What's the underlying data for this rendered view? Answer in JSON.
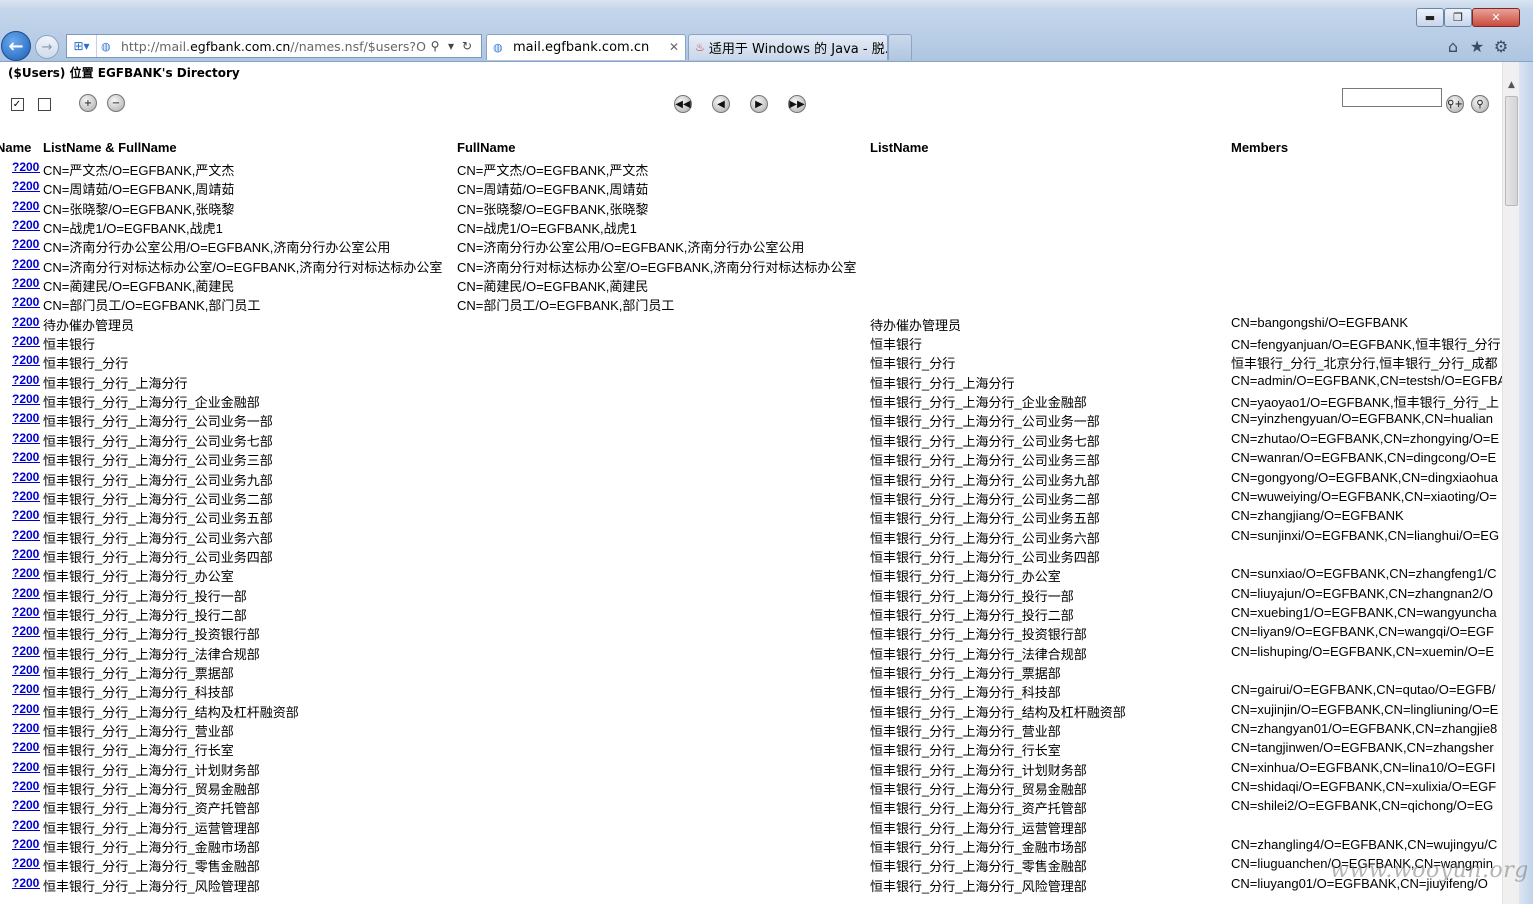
{
  "browser": {
    "address_url_prefix": "http://mail.",
    "address_url_domain": "egfbank.com.cn",
    "address_url_rest": "//names.nsf/$users?Oper",
    "tabs": [
      {
        "label": "mail.egfbank.com.cn",
        "active": true
      },
      {
        "label": "适用于 Windows 的 Java - 脱...",
        "active": false
      }
    ],
    "window_buttons": {
      "minimize": "▬",
      "maximize": "❐",
      "close": "✕"
    },
    "icons": [
      "back-arrow-icon",
      "forward-arrow-icon",
      "compat-view-icon",
      "favicon-icon",
      "search-icon",
      "dropdown-icon",
      "refresh-icon",
      "close-icon",
      "home-icon",
      "star-icon",
      "gear-icon"
    ]
  },
  "view": {
    "title": "($Users) 位置 EGFBANK's Directory",
    "toolbar_icons": [
      "select-all-icon",
      "deselect-all-icon",
      "expand-all-icon",
      "collapse-all-icon",
      "first-page-icon",
      "previous-page-icon",
      "next-page-icon",
      "last-page-icon",
      "search-options-icon",
      "search-icon"
    ],
    "columns": [
      "Name",
      "ListName & FullName",
      "FullName",
      "ListName",
      "Members"
    ],
    "rows": [
      {
        "link": "?2000",
        "name": "CN=严文杰/O=EGFBANK,严文杰",
        "fullname": "CN=严文杰/O=EGFBANK,严文杰",
        "listname": "",
        "members": ""
      },
      {
        "link": "?2000",
        "name": "CN=周靖茹/O=EGFBANK,周靖茹",
        "fullname": "CN=周靖茹/O=EGFBANK,周靖茹",
        "listname": "",
        "members": ""
      },
      {
        "link": "?2000",
        "name": "CN=张晓黎/O=EGFBANK,张晓黎",
        "fullname": "CN=张晓黎/O=EGFBANK,张晓黎",
        "listname": "",
        "members": ""
      },
      {
        "link": "?2000",
        "name": "CN=战虎1/O=EGFBANK,战虎1",
        "fullname": "CN=战虎1/O=EGFBANK,战虎1",
        "listname": "",
        "members": ""
      },
      {
        "link": "?2000",
        "name": "CN=济南分行办公室公用/O=EGFBANK,济南分行办公室公用",
        "fullname": "CN=济南分行办公室公用/O=EGFBANK,济南分行办公室公用",
        "listname": "",
        "members": ""
      },
      {
        "link": "?2000",
        "name": "CN=济南分行对标达标办公室/O=EGFBANK,济南分行对标达标办公室",
        "fullname": "CN=济南分行对标达标办公室/O=EGFBANK,济南分行对标达标办公室",
        "listname": "",
        "members": ""
      },
      {
        "link": "?2000",
        "name": "CN=蔺建民/O=EGFBANK,蔺建民",
        "fullname": "CN=蔺建民/O=EGFBANK,蔺建民",
        "listname": "",
        "members": ""
      },
      {
        "link": "?2000",
        "name": "CN=部门员工/O=EGFBANK,部门员工",
        "fullname": "CN=部门员工/O=EGFBANK,部门员工",
        "listname": "",
        "members": ""
      },
      {
        "link": "?2000",
        "name": "待办催办管理员",
        "fullname": "",
        "listname": "待办催办管理员",
        "members": "CN=bangongshi/O=EGFBANK"
      },
      {
        "link": "?2000",
        "name": "恒丰银行",
        "fullname": "",
        "listname": "恒丰银行",
        "members": "CN=fengyanjuan/O=EGFBANK,恒丰银行_分行"
      },
      {
        "link": "?2000",
        "name": "恒丰银行_分行",
        "fullname": "",
        "listname": "恒丰银行_分行",
        "members": "恒丰银行_分行_北京分行,恒丰银行_分行_成都"
      },
      {
        "link": "?2000",
        "name": "恒丰银行_分行_上海分行",
        "fullname": "",
        "listname": "恒丰银行_分行_上海分行",
        "members": "CN=admin/O=EGFBANK,CN=testsh/O=EGFBANK"
      },
      {
        "link": "?2000",
        "name": "恒丰银行_分行_上海分行_企业金融部",
        "fullname": "",
        "listname": "恒丰银行_分行_上海分行_企业金融部",
        "members": "CN=yaoyao1/O=EGFBANK,恒丰银行_分行_上"
      },
      {
        "link": "?2000",
        "name": "恒丰银行_分行_上海分行_公司业务一部",
        "fullname": "",
        "listname": "恒丰银行_分行_上海分行_公司业务一部",
        "members": "CN=yinzhengyuan/O=EGFBANK,CN=hualian"
      },
      {
        "link": "?2000",
        "name": "恒丰银行_分行_上海分行_公司业务七部",
        "fullname": "",
        "listname": "恒丰银行_分行_上海分行_公司业务七部",
        "members": "CN=zhutao/O=EGFBANK,CN=zhongying/O=E"
      },
      {
        "link": "?2000",
        "name": "恒丰银行_分行_上海分行_公司业务三部",
        "fullname": "",
        "listname": "恒丰银行_分行_上海分行_公司业务三部",
        "members": "CN=wanran/O=EGFBANK,CN=dingcong/O=E"
      },
      {
        "link": "?2000",
        "name": "恒丰银行_分行_上海分行_公司业务九部",
        "fullname": "",
        "listname": "恒丰银行_分行_上海分行_公司业务九部",
        "members": "CN=gongyong/O=EGFBANK,CN=dingxiaohua"
      },
      {
        "link": "?2000",
        "name": "恒丰银行_分行_上海分行_公司业务二部",
        "fullname": "",
        "listname": "恒丰银行_分行_上海分行_公司业务二部",
        "members": "CN=wuweiying/O=EGFBANK,CN=xiaoting/O="
      },
      {
        "link": "?2000",
        "name": "恒丰银行_分行_上海分行_公司业务五部",
        "fullname": "",
        "listname": "恒丰银行_分行_上海分行_公司业务五部",
        "members": "CN=zhangjiang/O=EGFBANK"
      },
      {
        "link": "?2000",
        "name": "恒丰银行_分行_上海分行_公司业务六部",
        "fullname": "",
        "listname": "恒丰银行_分行_上海分行_公司业务六部",
        "members": "CN=sunjinxi/O=EGFBANK,CN=lianghui/O=EG"
      },
      {
        "link": "?2000",
        "name": "恒丰银行_分行_上海分行_公司业务四部",
        "fullname": "",
        "listname": "恒丰银行_分行_上海分行_公司业务四部",
        "members": ""
      },
      {
        "link": "?2000",
        "name": "恒丰银行_分行_上海分行_办公室",
        "fullname": "",
        "listname": "恒丰银行_分行_上海分行_办公室",
        "members": "CN=sunxiao/O=EGFBANK,CN=zhangfeng1/C"
      },
      {
        "link": "?2000",
        "name": "恒丰银行_分行_上海分行_投行一部",
        "fullname": "",
        "listname": "恒丰银行_分行_上海分行_投行一部",
        "members": "CN=liuyajun/O=EGFBANK,CN=zhangnan2/O"
      },
      {
        "link": "?2000",
        "name": "恒丰银行_分行_上海分行_投行二部",
        "fullname": "",
        "listname": "恒丰银行_分行_上海分行_投行二部",
        "members": "CN=xuebing1/O=EGFBANK,CN=wangyuncha"
      },
      {
        "link": "?2000",
        "name": "恒丰银行_分行_上海分行_投资银行部",
        "fullname": "",
        "listname": "恒丰银行_分行_上海分行_投资银行部",
        "members": "CN=liyan9/O=EGFBANK,CN=wangqi/O=EGF"
      },
      {
        "link": "?2000",
        "name": "恒丰银行_分行_上海分行_法律合规部",
        "fullname": "",
        "listname": "恒丰银行_分行_上海分行_法律合规部",
        "members": "CN=lishuping/O=EGFBANK,CN=xuemin/O=E"
      },
      {
        "link": "?2000",
        "name": "恒丰银行_分行_上海分行_票据部",
        "fullname": "",
        "listname": "恒丰银行_分行_上海分行_票据部",
        "members": ""
      },
      {
        "link": "?2000",
        "name": "恒丰银行_分行_上海分行_科技部",
        "fullname": "",
        "listname": "恒丰银行_分行_上海分行_科技部",
        "members": "CN=gairui/O=EGFBANK,CN=qutao/O=EGFB/"
      },
      {
        "link": "?2000",
        "name": "恒丰银行_分行_上海分行_结构及杠杆融资部",
        "fullname": "",
        "listname": "恒丰银行_分行_上海分行_结构及杠杆融资部",
        "members": "CN=xujinjin/O=EGFBANK,CN=lingliuning/O=E"
      },
      {
        "link": "?2000",
        "name": "恒丰银行_分行_上海分行_营业部",
        "fullname": "",
        "listname": "恒丰银行_分行_上海分行_营业部",
        "members": "CN=zhangyan01/O=EGFBANK,CN=zhangjie8"
      },
      {
        "link": "?2000",
        "name": "恒丰银行_分行_上海分行_行长室",
        "fullname": "",
        "listname": "恒丰银行_分行_上海分行_行长室",
        "members": "CN=tangjinwen/O=EGFBANK,CN=zhangsher"
      },
      {
        "link": "?2000",
        "name": "恒丰银行_分行_上海分行_计划财务部",
        "fullname": "",
        "listname": "恒丰银行_分行_上海分行_计划财务部",
        "members": "CN=xinhua/O=EGFBANK,CN=lina10/O=EGFI"
      },
      {
        "link": "?2000",
        "name": "恒丰银行_分行_上海分行_贸易金融部",
        "fullname": "",
        "listname": "恒丰银行_分行_上海分行_贸易金融部",
        "members": "CN=shidaqi/O=EGFBANK,CN=xulixia/O=EGF"
      },
      {
        "link": "?2000",
        "name": "恒丰银行_分行_上海分行_资产托管部",
        "fullname": "",
        "listname": "恒丰银行_分行_上海分行_资产托管部",
        "members": "CN=shilei2/O=EGFBANK,CN=qichong/O=EG"
      },
      {
        "link": "?2000",
        "name": "恒丰银行_分行_上海分行_运营管理部",
        "fullname": "",
        "listname": "恒丰银行_分行_上海分行_运营管理部",
        "members": ""
      },
      {
        "link": "?2000",
        "name": "恒丰银行_分行_上海分行_金融市场部",
        "fullname": "",
        "listname": "恒丰银行_分行_上海分行_金融市场部",
        "members": "CN=zhangling4/O=EGFBANK,CN=wujingyu/C"
      },
      {
        "link": "?2000",
        "name": "恒丰银行_分行_上海分行_零售金融部",
        "fullname": "",
        "listname": "恒丰银行_分行_上海分行_零售金融部",
        "members": "CN=liuguanchen/O=EGFBANK,CN=wangmin"
      },
      {
        "link": "?2000",
        "name": "恒丰银行_分行_上海分行_风险管理部",
        "fullname": "",
        "listname": "恒丰银行_分行_上海分行_风险管理部",
        "members": "CN=liuyang01/O=EGFBANK,CN=jiuyifeng/O"
      }
    ]
  },
  "watermark": "www.wooyun.org"
}
